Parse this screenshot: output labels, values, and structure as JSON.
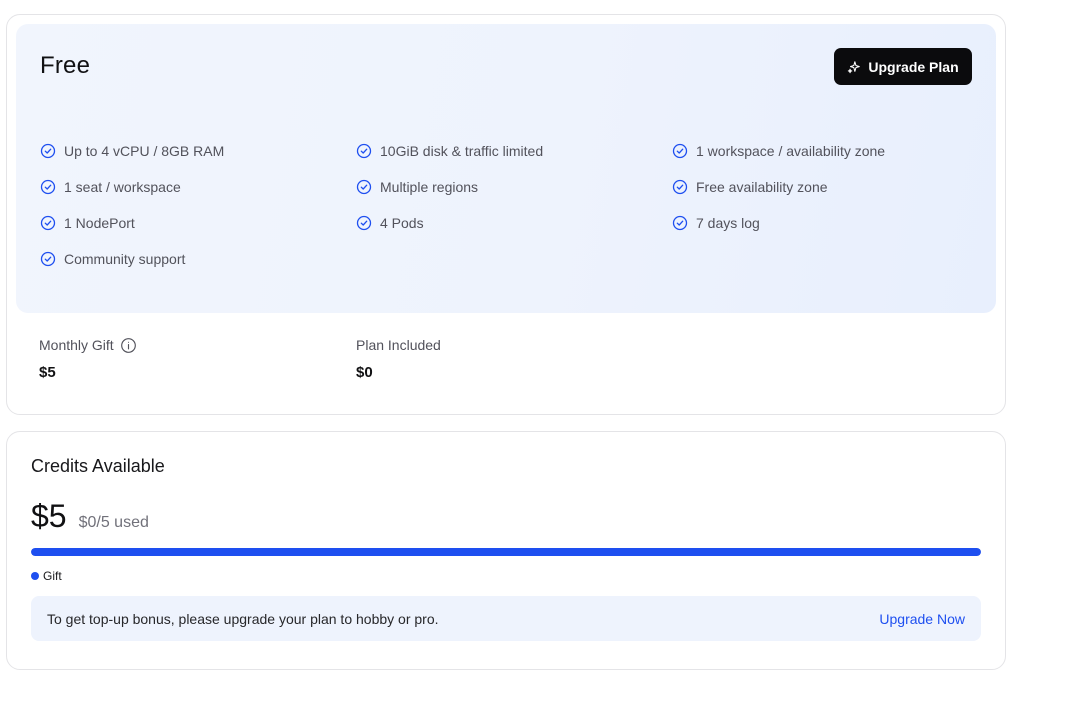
{
  "plan": {
    "name": "Free",
    "upgrade_label": "Upgrade Plan",
    "features": [
      "Up to 4 vCPU / 8GB RAM",
      "10GiB disk & traffic limited",
      "1 workspace / availability zone",
      "1 seat / workspace",
      "Multiple regions",
      "Free availability zone",
      "1 NodePort",
      "4 Pods",
      "7 days log",
      "Community support"
    ],
    "monthly_gift_label": "Monthly Gift",
    "monthly_gift_value": "$5",
    "plan_included_label": "Plan Included",
    "plan_included_value": "$0"
  },
  "credits": {
    "title": "Credits Available",
    "amount": "$5",
    "used": "$0/5 used",
    "progress_fraction": 1.0,
    "legend_label": "Gift",
    "bonus_text": "To get top-up bonus, please upgrade your plan to hobby or pro.",
    "bonus_link": "Upgrade Now"
  },
  "colors": {
    "accent": "#1e4ff0",
    "button_bg": "#0b0b0d",
    "hero_bg": "#eef3fd"
  },
  "icons": {
    "feature": "check-circle-icon",
    "upgrade": "sparkle-icon",
    "info": "info-icon"
  }
}
